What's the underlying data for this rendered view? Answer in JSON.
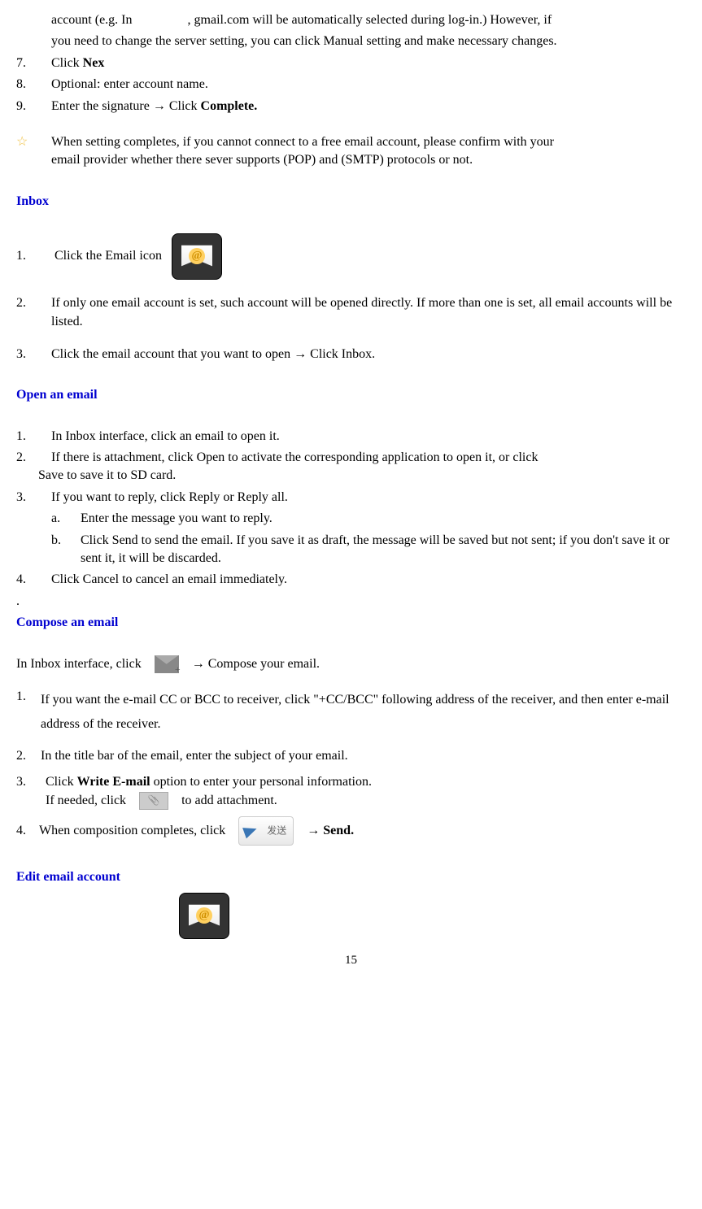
{
  "top": {
    "line1_a": "account (e.g. In",
    "line1_b": ", gmail.com will be automatically selected during log-in.) However, if",
    "line2": "you need to change the server setting, you can click Manual setting and make necessary changes.",
    "item7_num": "7.",
    "item7_a": "Click ",
    "item7_b": "Nex",
    "item8_num": "8.",
    "item8": "Optional: enter account name.",
    "item9_num": "9.",
    "item9_a": "Enter the signature → Click ",
    "item9_b": "Complete."
  },
  "note": {
    "star": "☆",
    "text_a": "When setting completes, if you cannot connect to a free email account, please confirm with your",
    "text_b": "email provider whether there sever supports (POP)    and (SMTP) protocols or not."
  },
  "inbox": {
    "heading": "Inbox",
    "i1_num": "1.",
    "i1": "Click the Email icon",
    "i2_num": "2.",
    "i2": "If only one email account is set, such account will be opened directly. If more than one is set, all email accounts will be listed.",
    "i3_num": "3.",
    "i3": "Click the email account that you want to open → Click Inbox."
  },
  "open": {
    "heading": "Open an email",
    "o1_num": "1.",
    "o1": "In Inbox interface, click an email to open it.",
    "o2_num": "2.",
    "o2": "If there is attachment, click Open to activate the corresponding application to open it, or click Save to save it to SD card.",
    "o3_num": "3.",
    "o3": "If you want to reply, click Reply or Reply all.",
    "o3a_num": "a.",
    "o3a": "Enter the message you want to reply.",
    "o3b_num": "b.",
    "o3b": "Click Send to send the email. If you save it as draft, the message will be saved but not sent; if you don't save it or sent it, it will be discarded.",
    "o4_num": "4.",
    "o4": "Click Cancel to cancel an email immediately.",
    "dot": "."
  },
  "compose": {
    "heading": "Compose an email",
    "intro_a": "In Inbox interface, click",
    "intro_b": "→ Compose your email.",
    "c1_num": "1.",
    "c1": "If you want the e-mail CC or BCC to receiver, click \"+CC/BCC\" following address of the receiver, and then enter e-mail address of the receiver.",
    "c2_num": "2.",
    "c2": "In the title bar of the email, enter the subject of your email.",
    "c3_num": "3.",
    "c3_a": "Click ",
    "c3_bold": "Write E-mail",
    "c3_b": " option to enter your personal information.",
    "c3_line2a": "If needed, click",
    "c3_line2b": "to add attachment.",
    "c4_num": "4.",
    "c4a": "When composition completes, click",
    "c4b": "→",
    "c4bold": "Send."
  },
  "edit": {
    "heading": "Edit email account"
  },
  "page": "15"
}
